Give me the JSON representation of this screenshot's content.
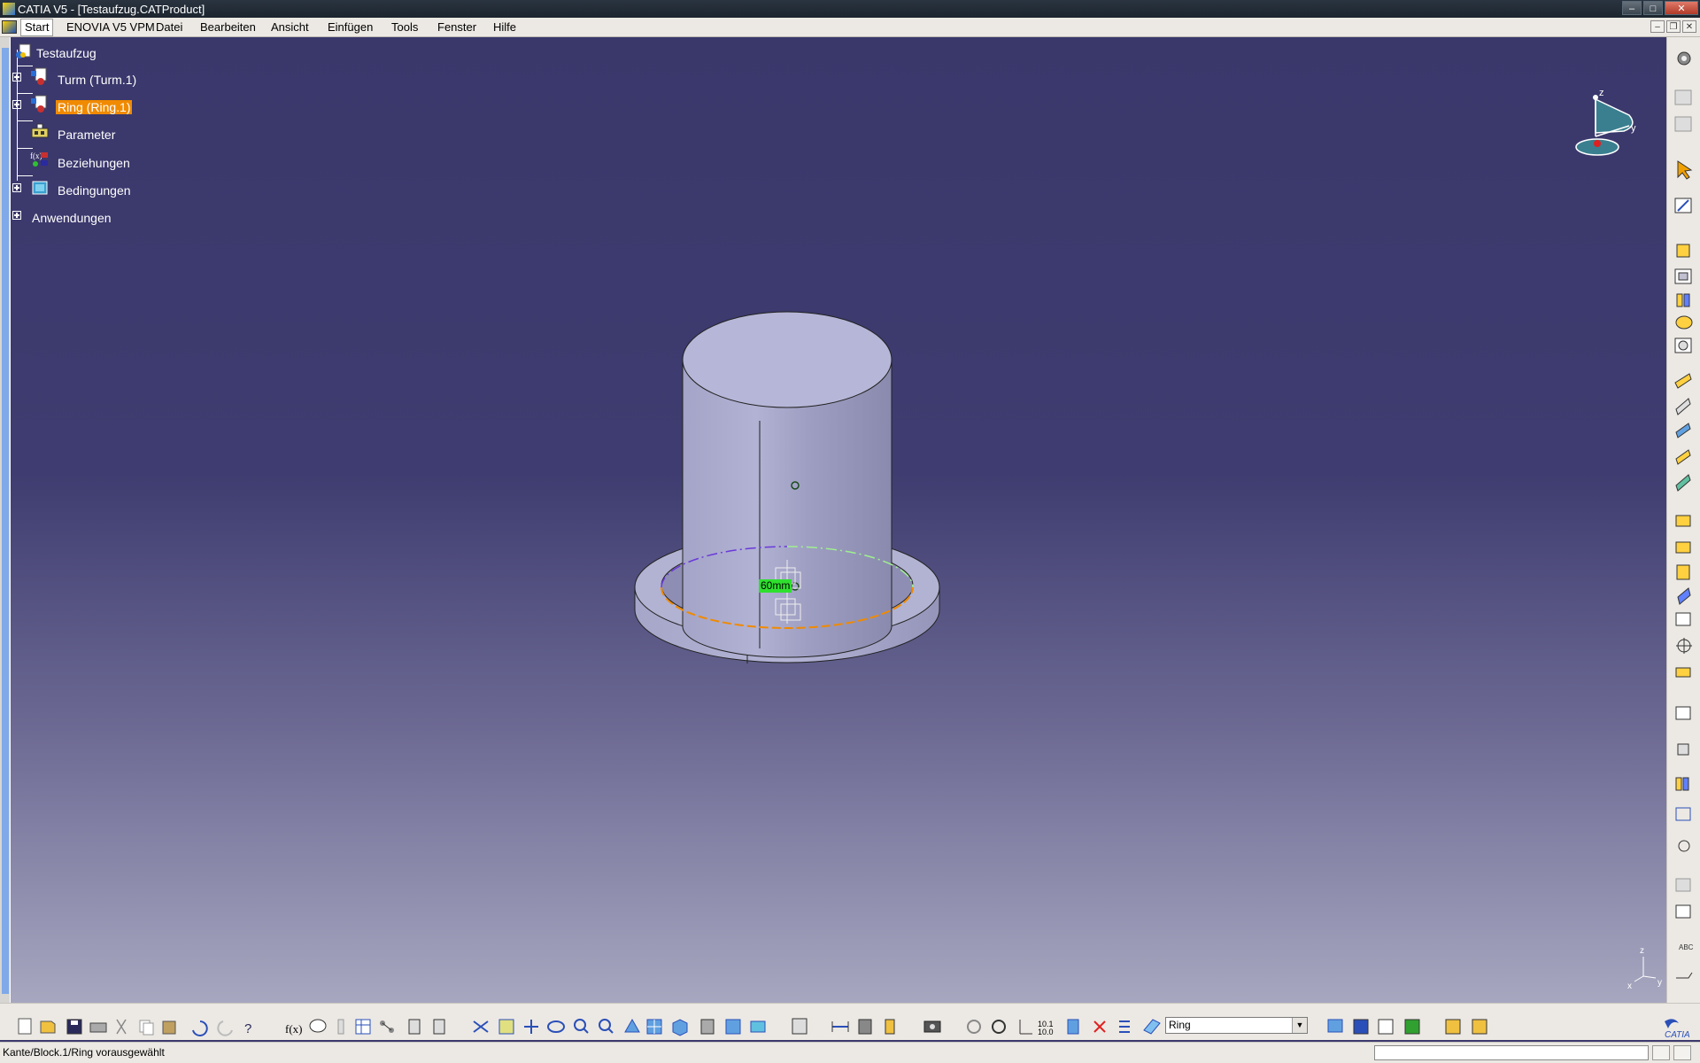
{
  "window": {
    "title": "CATIA V5 - [Testaufzug.CATProduct]",
    "controls": [
      "–",
      "□",
      "✕"
    ]
  },
  "menubar": {
    "items": [
      "Start",
      "ENOVIA V5 VPM",
      "Datei",
      "Bearbeiten",
      "Ansicht",
      "Einfügen",
      "Tools",
      "Fenster",
      "Hilfe"
    ],
    "active": "Start"
  },
  "tree": {
    "root": "Testaufzug",
    "nodes": [
      {
        "label": "Turm (Turm.1)",
        "icon": "part-icon",
        "expandable": true
      },
      {
        "label": "Ring (Ring.1)",
        "icon": "part-icon",
        "expandable": true,
        "selected": true
      },
      {
        "label": "Parameter",
        "icon": "parameter-icon",
        "expandable": false
      },
      {
        "label": "Beziehungen",
        "icon": "relations-icon",
        "expandable": false
      },
      {
        "label": "Bedingungen",
        "icon": "constraints-icon",
        "expandable": true
      },
      {
        "label": "Anwendungen",
        "icon": "",
        "expandable": true
      }
    ]
  },
  "viewport": {
    "dimension_label": "60mm",
    "compass_axes": {
      "z": "z",
      "y": "y"
    },
    "corner_axes": {
      "z": "z",
      "x": "x",
      "y": "y"
    },
    "colors": {
      "background_top": "#3a376b",
      "background_bottom": "#a7a7c0",
      "part": "#a9a9cc",
      "selection": "#f08a00"
    }
  },
  "bottom_toolbar": {
    "current_selection_value": "Ring",
    "icons": [
      "new-icon",
      "open-icon",
      "save-icon",
      "print-icon",
      "cut-icon",
      "copy-icon",
      "paste-icon",
      "undo-icon",
      "redo-icon",
      "help-icon",
      "formula-icon",
      "comment-icon",
      "sketch-icon",
      "table-icon",
      "tree-icon",
      "catalog-icon",
      "bill-icon",
      "fit-all-icon",
      "select-icon",
      "pan-icon",
      "rotate-icon",
      "zoom-in-icon",
      "zoom-out-icon",
      "normal-view-icon",
      "multi-view-icon",
      "iso-view-icon",
      "shading-icon",
      "hide-show-icon",
      "swap-icon",
      "update-icon",
      "measure-icon",
      "inertia-icon",
      "weight-icon",
      "camera-icon",
      "refresh-icon",
      "power-icon",
      "axis-icon",
      "number-icon",
      "layer-icon",
      "cross-icon",
      "list-icon",
      "filter-icon",
      "paint-icon",
      "graph-icon",
      "analysis-icon",
      "material-icon",
      "render-icon",
      "viewer-icon"
    ],
    "catia_logo": "CATIA"
  },
  "right_toolbar": {
    "icons": [
      "options-icon",
      "drafting-icon",
      "clipboard-icon",
      "arrow-select-icon",
      "sketcher-icon",
      "pad-icon",
      "pocket-icon",
      "shaft-icon",
      "groove-icon",
      "hole-icon",
      "rib-icon",
      "slot-icon",
      "stiffener-icon",
      "loft-icon",
      "fillet-icon",
      "chamfer-icon",
      "draft-icon",
      "shell-icon",
      "thickness-icon",
      "thread-icon",
      "translate-icon",
      "mirror-icon",
      "pattern-icon",
      "scale-icon",
      "boolean-icon",
      "assemble-icon",
      "add-icon",
      "remove-icon",
      "intersect-icon",
      "trim-icon",
      "text-icon",
      "annotation-icon"
    ],
    "abc_label": "ABC"
  },
  "status": {
    "message": "Kante/Block.1/Ring vorausgewählt"
  }
}
